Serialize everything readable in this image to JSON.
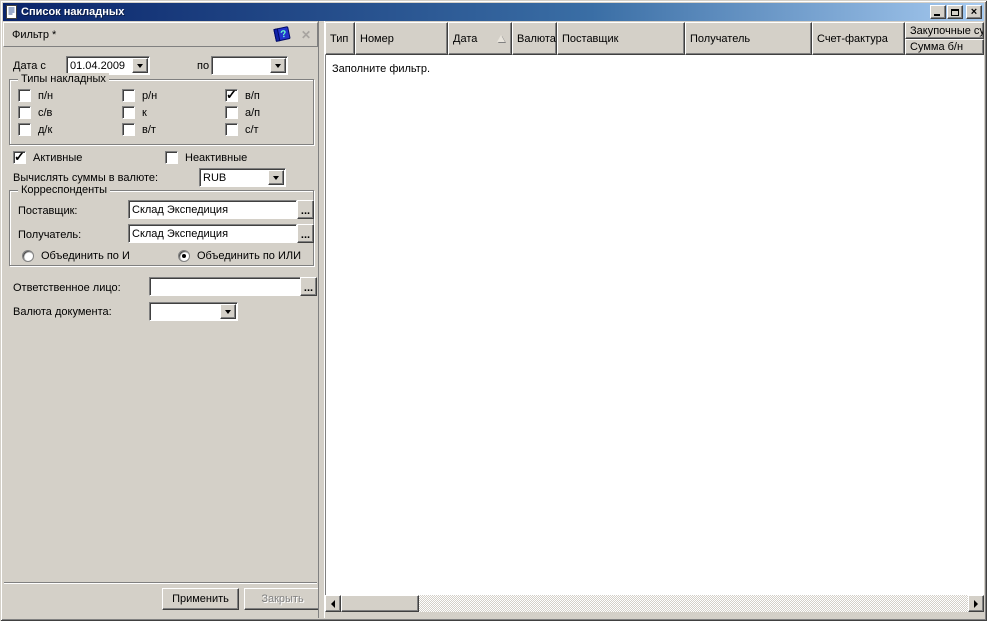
{
  "window": {
    "title": "Список накладных"
  },
  "colors": {
    "titlebar_start": "#0a246a",
    "titlebar_end": "#a6caf0",
    "chrome": "#d4d0c8",
    "field_bg": "#ffffff"
  },
  "icons": {
    "document": "document-icon",
    "help_book": "?",
    "close_small": "✕",
    "ellipsis": "...",
    "window_close": "×"
  },
  "filter": {
    "header_title": "Фильтр *",
    "date_from_label": "Дата с",
    "date_from_value": "01.04.2009",
    "date_to_label": "по",
    "date_to_value": "",
    "types_group": {
      "title": "Типы накладных",
      "items": [
        {
          "label": "п/н",
          "checked": false
        },
        {
          "label": "р/н",
          "checked": false
        },
        {
          "label": "в/п",
          "checked": true
        },
        {
          "label": "с/в",
          "checked": false
        },
        {
          "label": "к",
          "checked": false
        },
        {
          "label": "а/п",
          "checked": false
        },
        {
          "label": "д/к",
          "checked": false
        },
        {
          "label": "в/т",
          "checked": false
        },
        {
          "label": "с/т",
          "checked": false
        }
      ]
    },
    "active_label": "Активные",
    "active_checked": true,
    "inactive_label": "Неактивные",
    "inactive_checked": false,
    "calc_currency_label": "Вычислять суммы в валюте:",
    "calc_currency_value": "RUB",
    "correspondents_group": {
      "title": "Корреспонденты",
      "supplier_label": "Поставщик:",
      "supplier_value": "Склад Экспедиция",
      "receiver_label": "Получатель:",
      "receiver_value": "Склад Экспедиция",
      "join_and_label": "Объединить по И",
      "join_and_selected": false,
      "join_or_label": "Объединить по ИЛИ",
      "join_or_selected": true
    },
    "responsible_label": "Ответственное лицо:",
    "responsible_value": "",
    "doc_currency_label": "Валюта документа:",
    "doc_currency_value": "",
    "apply_button": "Применить",
    "close_button": "Закрыть"
  },
  "table": {
    "columns": [
      {
        "label": "Тип"
      },
      {
        "label": "Номер"
      },
      {
        "label": "Дата",
        "sorted": "asc"
      },
      {
        "label": "Валюта"
      },
      {
        "label": "Поставщик"
      },
      {
        "label": "Получатель"
      },
      {
        "label": "Счет-фактура"
      },
      {
        "label": "Закупочные су"
      }
    ],
    "subcolumn_label": "Сумма б/н",
    "empty_message": "Заполните фильтр."
  }
}
